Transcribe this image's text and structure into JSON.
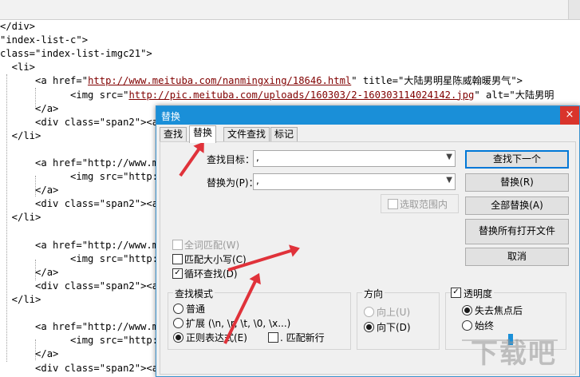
{
  "editor": {
    "lines": [
      "</div>",
      "\"index-list-c\">",
      "class=\"index-list-imgc21\">",
      "  <li>",
      "      <a href=\"http://www.meituba.com/nanmingxing/18646.html\" title=\"大陆男明星陈威翰暖男气\">",
      "            <img src=\"http://pic.meituba.com/uploads/160303/2-160303114024142.jpg\" alt=\"大陆男明",
      "      </a>",
      "      <div class=\"span2\"><a",
      "  </li>",
      "",
      "      <a href=\"http://www.m",
      "            <img src=\"http:",
      "      </a>",
      "      <div class=\"span2\"><a",
      "  </li>",
      "",
      "      <a href=\"http://www.m",
      "            <img src=\"http:",
      "      </a>",
      "      <div class=\"span2\"><a",
      "  </li>",
      "",
      "      <a href=\"http://www.m",
      "            <img src=\"http:",
      "      </a>",
      "      <div class=\"span2\"><a"
    ]
  },
  "dialog": {
    "title": "替换",
    "close_symbol": "×",
    "tabs": [
      "查找",
      "替换",
      "文件查找",
      "标记"
    ],
    "find_label": "查找目标：",
    "find_value": ",",
    "replace_label": "替换为(P)：",
    "replace_value": ",",
    "in_selection_label": "选取范围内",
    "buttons": {
      "find_next": "查找下一个",
      "replace": "替换(R)",
      "replace_all": "全部替换(A)",
      "replace_all_open": "替换所有打开文件",
      "cancel": "取消"
    },
    "options": {
      "whole_word": "全词匹配(W)",
      "match_case": "匹配大小写(C)",
      "wrap_around": "循环查找(D)"
    },
    "search_mode": {
      "title": "查找模式",
      "normal": "普通",
      "extended": "扩展 (\\n, \\r, \\t, \\0, \\x...)",
      "regex": "正则表达式(E)",
      "dot_newline": ". 匹配新行"
    },
    "direction": {
      "title": "方向",
      "up": "向上(U)",
      "down": "向下(D)"
    },
    "transparency": {
      "title": "透明度",
      "on_lose_focus": "失去焦点后",
      "always": "始终"
    }
  },
  "watermark": "下载吧"
}
